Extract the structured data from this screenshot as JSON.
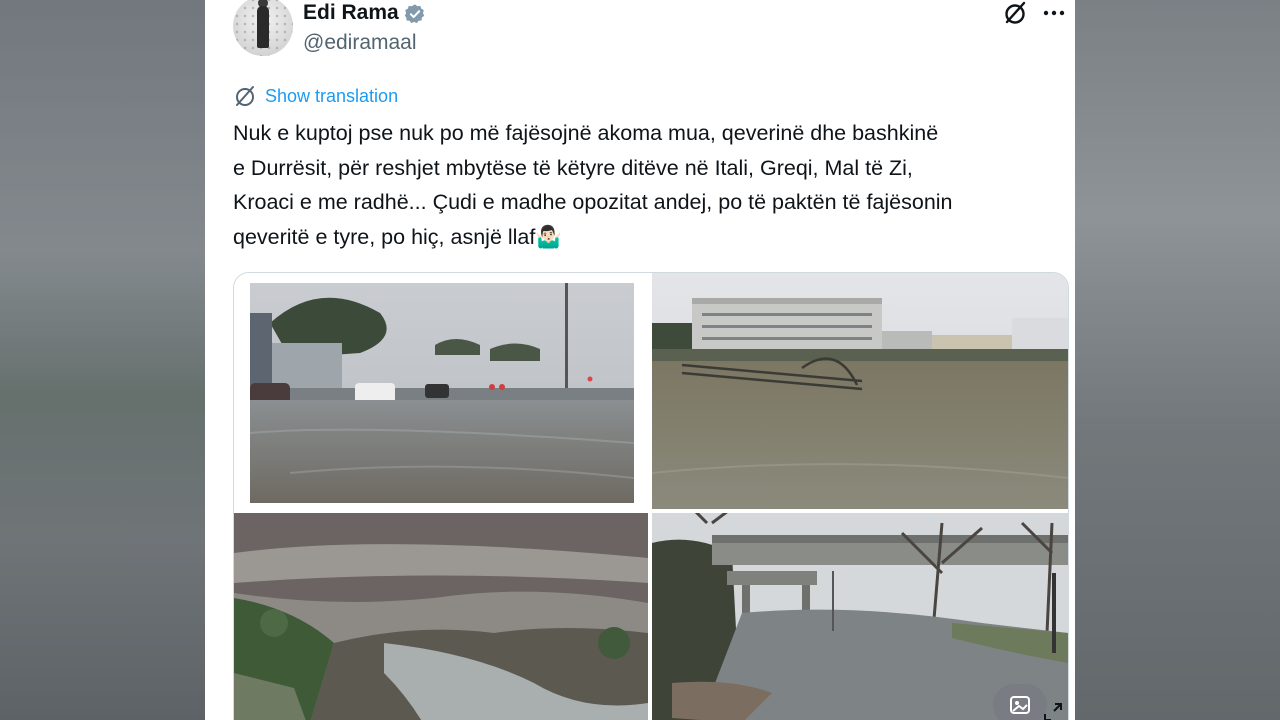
{
  "tweet": {
    "author_name": "Edi Rama",
    "handle": "@ediramaal",
    "translate_label": "Show translation",
    "text": "Nuk e kuptoj pse nuk po më fajësojnë akoma mua, qeverinë dhe bashkinë\ne Durrësit, për reshjet mbytëse të këtyre ditëve në Itali, Greqi, Mal të Zi,\nKroaci e me radhë... Çudi e madhe opozitat andej, po të paktën të fajësonin\nqeveritë e tyre, po hiç, asnjë llaf🤷🏻‍♂️"
  },
  "icons": {
    "verified": "verified-badge-icon",
    "grok": "grok-icon",
    "more": "more-icon",
    "translate": "translate-icon",
    "image_description": "image-icon",
    "expand": "expand-icon"
  },
  "media": {
    "photos": [
      {
        "name": "flooded-street-photo"
      },
      {
        "name": "flooded-building-photo"
      },
      {
        "name": "flooded-valley-photo"
      },
      {
        "name": "flooded-underpass-photo"
      }
    ]
  },
  "colors": {
    "link": "#1d9bf0",
    "verified": "#829aab",
    "text": "#0f1419",
    "secondary": "#536471"
  }
}
